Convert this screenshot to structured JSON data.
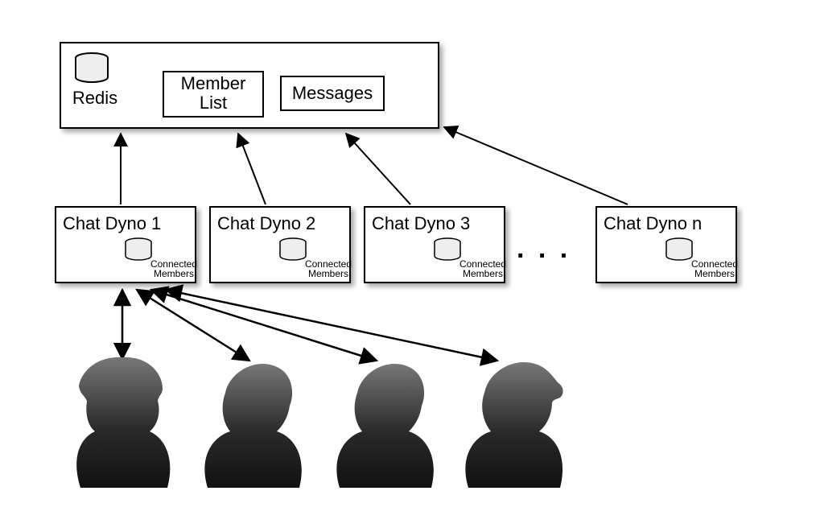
{
  "diagram": {
    "redis_box": {
      "db_label": "Redis",
      "sub1_line1": "Member",
      "sub1_line2": "List",
      "sub2": "Messages"
    },
    "dynos": [
      {
        "title": "Chat Dyno 1",
        "db_line1": "Connected",
        "db_line2": "Members"
      },
      {
        "title": "Chat Dyno 2",
        "db_line1": "Connected",
        "db_line2": "Members"
      },
      {
        "title": "Chat Dyno 3",
        "db_line1": "Connected",
        "db_line2": "Members"
      },
      {
        "title": "Chat Dyno n",
        "db_line1": "Connected",
        "db_line2": "Members"
      }
    ],
    "ellipsis": ". . ."
  }
}
